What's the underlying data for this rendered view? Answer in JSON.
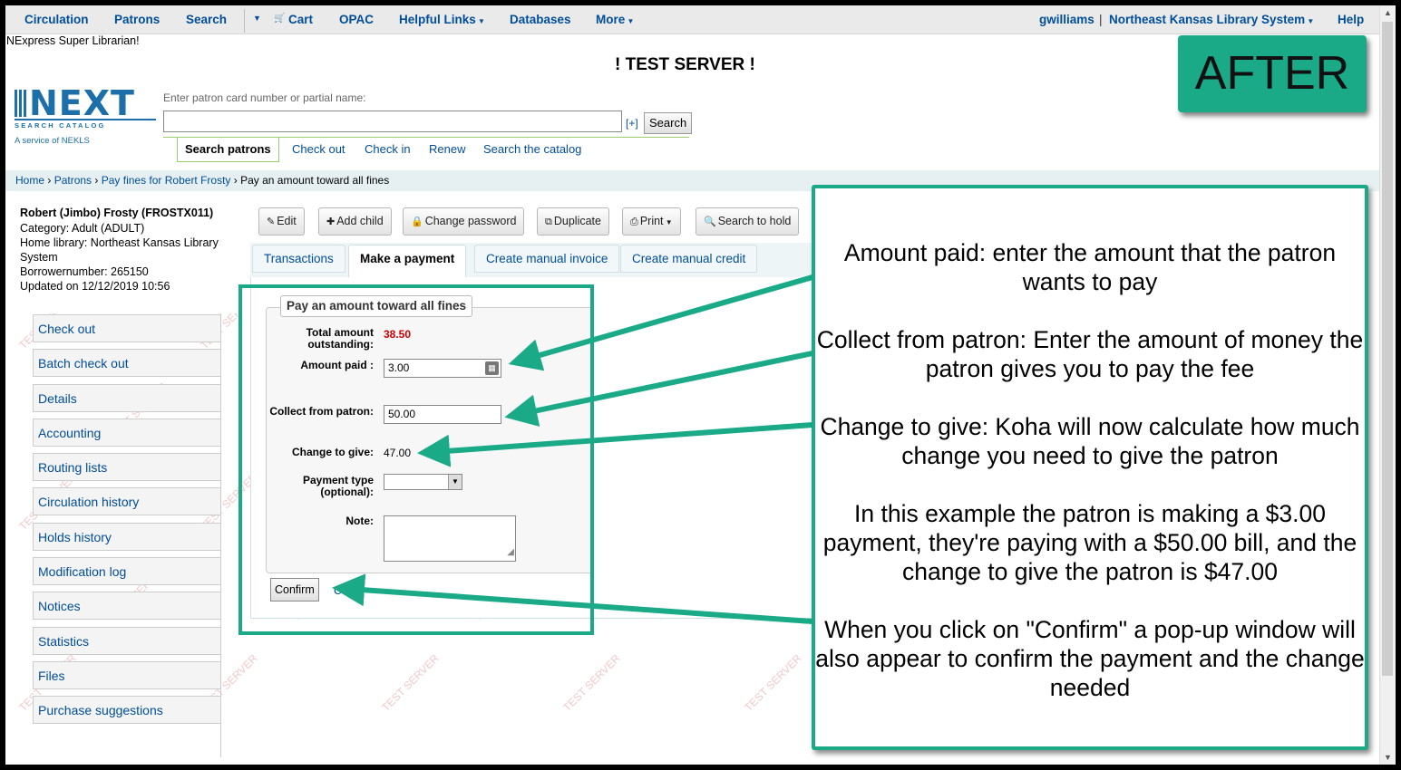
{
  "topnav": {
    "items": [
      "Circulation",
      "Patrons",
      "Search",
      "Cart",
      "OPAC",
      "Helpful Links",
      "Databases",
      "More"
    ],
    "user": "gwilliams",
    "library": "Northeast Kansas Library System",
    "help": "Help"
  },
  "librarian_line": "NExpress Super Librarian!",
  "test_server": "! TEST SERVER !",
  "logo": {
    "word": "NEXT",
    "sub": "SEARCH CATALOG",
    "service": "A service of NEKLS"
  },
  "search": {
    "label": "Enter patron card number or partial name:",
    "value": "",
    "plus": "[+]",
    "button": "Search"
  },
  "search_tabs": [
    "Search patrons",
    "Check out",
    "Check in",
    "Renew",
    "Search the catalog"
  ],
  "breadcrumb": {
    "home": "Home",
    "patrons": "Patrons",
    "pay_fines": "Pay fines for Robert Frosty",
    "current": "Pay an amount toward all fines"
  },
  "patron": {
    "name": "Robert (Jimbo) Frosty (FROSTX011)",
    "category": "Category: Adult (ADULT)",
    "home_library": "Home library: Northeast Kansas Library System",
    "borrowernumber": "Borrowernumber: 265150",
    "updated": "Updated on 12/12/2019 10:56"
  },
  "menu": [
    "Check out",
    "Batch check out",
    "Details",
    "Accounting",
    "Routing lists",
    "Circulation history",
    "Holds history",
    "Modification log",
    "Notices",
    "Statistics",
    "Files",
    "Purchase suggestions"
  ],
  "toolbar": [
    "Edit",
    "Add child",
    "Change password",
    "Duplicate",
    "Print",
    "Search to hold"
  ],
  "pay_tabs": [
    "Transactions",
    "Make a payment",
    "Create manual invoice",
    "Create manual credit"
  ],
  "form": {
    "legend": "Pay an amount toward all fines",
    "total_label": "Total amount outstanding:",
    "total_value": "38.50",
    "amount_label": "Amount paid :",
    "amount_value": "3.00",
    "collect_label": "Collect from patron:",
    "collect_value": "50.00",
    "change_label": "Change to give:",
    "change_value": "47.00",
    "paytype_label": "Payment type (optional):",
    "paytype_value": "",
    "note_label": "Note:",
    "confirm": "Confirm",
    "cancel": "C"
  },
  "callout": [
    "Amount  paid: enter the amount that the patron wants to pay",
    "Collect from patron:  Enter the amount of money the patron gives you to pay the fee",
    "Change to give:  Koha will now calculate how much change you need to give the patron",
    "In this example the patron is making a $3.00 payment, they're paying with a $50.00 bill, and the change to give the patron is $47.00",
    "When you click on \"Confirm\" a pop-up window will also appear to confirm the payment and the change needed"
  ],
  "badge": "AFTER",
  "watermark_text": "TEST SERVER",
  "colors": {
    "accent_green": "#1aaa88",
    "link_blue": "#004d99",
    "amount_red": "#cc0000"
  }
}
